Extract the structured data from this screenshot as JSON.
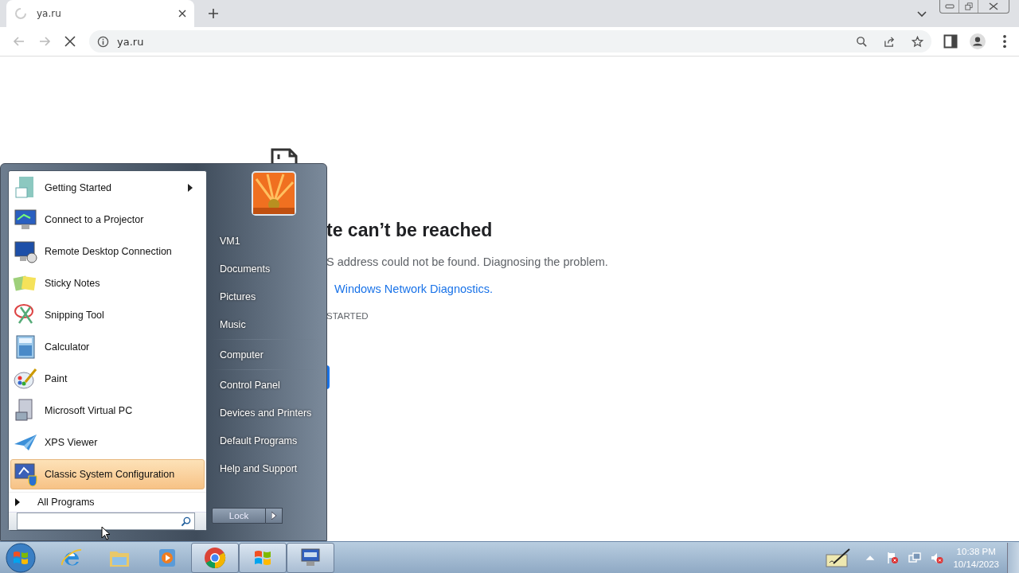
{
  "browser": {
    "tab": {
      "title": "ya.ru",
      "loading": true
    },
    "address": "ya.ru"
  },
  "error_page": {
    "heading": "te can’t be reached",
    "message": "S address could not be found. Diagnosing the problem.",
    "link": "Windows Network Diagnostics.",
    "label": "STARTED"
  },
  "start_menu": {
    "programs": [
      {
        "kind": "getting-started",
        "label": "Getting Started",
        "submenu": true,
        "selected": false
      },
      {
        "kind": "projector",
        "label": "Connect to a Projector",
        "submenu": false,
        "selected": false
      },
      {
        "kind": "remote",
        "label": "Remote Desktop Connection",
        "submenu": false,
        "selected": false
      },
      {
        "kind": "notes",
        "label": "Sticky Notes",
        "submenu": false,
        "selected": false
      },
      {
        "kind": "snip",
        "label": "Snipping Tool",
        "submenu": false,
        "selected": false
      },
      {
        "kind": "calc",
        "label": "Calculator",
        "submenu": false,
        "selected": false
      },
      {
        "kind": "paint",
        "label": "Paint",
        "submenu": false,
        "selected": false
      },
      {
        "kind": "vpc",
        "label": "Microsoft Virtual PC",
        "submenu": false,
        "selected": false
      },
      {
        "kind": "xps",
        "label": "XPS Viewer",
        "submenu": false,
        "selected": false
      },
      {
        "kind": "config",
        "label": "Classic System Configuration",
        "submenu": false,
        "selected": true
      }
    ],
    "all_programs": "All Programs",
    "place_groups": [
      [
        "VM1",
        "Documents",
        "Pictures",
        "Music"
      ],
      [
        "Computer"
      ],
      [
        "Control Panel",
        "Devices and Printers",
        "Default Programs",
        "Help and Support"
      ]
    ],
    "lock": "Lock"
  },
  "taskbar": {
    "apps": [
      {
        "kind": "ie",
        "active": false
      },
      {
        "kind": "explorer",
        "active": false
      },
      {
        "kind": "media",
        "active": false
      },
      {
        "kind": "chrome",
        "active": true
      },
      {
        "kind": "windows",
        "active": true
      },
      {
        "kind": "keyboard",
        "active": true
      }
    ],
    "time": "10:38 PM",
    "date": "10/14/2023"
  }
}
